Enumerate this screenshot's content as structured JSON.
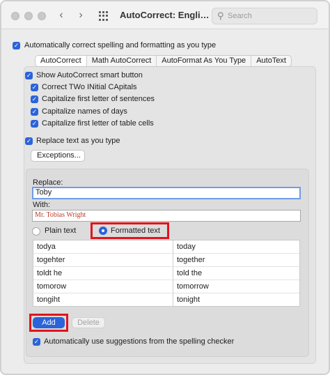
{
  "window": {
    "title": "AutoCorrect: Engli…",
    "search_placeholder": "Search"
  },
  "options": {
    "auto_correct_main": "Automatically correct spelling and formatting as you type",
    "show_smart_button": "Show AutoCorrect smart button",
    "correct_two_initial": "Correct TWo INitial CApitals",
    "capitalize_first_sentence": "Capitalize first letter of sentences",
    "capitalize_days": "Capitalize names of days",
    "capitalize_table_cells": "Capitalize first letter of table cells",
    "replace_text": "Replace text as you type",
    "exceptions_button": "Exceptions...",
    "auto_suggestions": "Automatically use suggestions from the spelling checker"
  },
  "tabs": [
    {
      "label": "AutoCorrect",
      "active": true
    },
    {
      "label": "Math AutoCorrect",
      "active": false
    },
    {
      "label": "AutoFormat As You Type",
      "active": false
    },
    {
      "label": "AutoText",
      "active": false
    }
  ],
  "replace_panel": {
    "replace_label": "Replace:",
    "replace_value": "Toby",
    "with_label": "With:",
    "with_value": "Mr. Tobias Wright",
    "plain_text_label": "Plain text",
    "formatted_text_label": "Formatted text",
    "selected_option": "Formatted text"
  },
  "table": {
    "rows": [
      {
        "replace": "todya",
        "with": "today"
      },
      {
        "replace": "togehter",
        "with": "together"
      },
      {
        "replace": "toldt he",
        "with": "told the"
      },
      {
        "replace": "tomorow",
        "with": "tomorrow"
      },
      {
        "replace": "tongiht",
        "with": "tonight"
      }
    ]
  },
  "buttons": {
    "add": "Add",
    "delete": "Delete"
  },
  "colors": {
    "accent": "#2b63d9",
    "highlight": "#e2141b",
    "formatted_text": "#c0392b"
  }
}
